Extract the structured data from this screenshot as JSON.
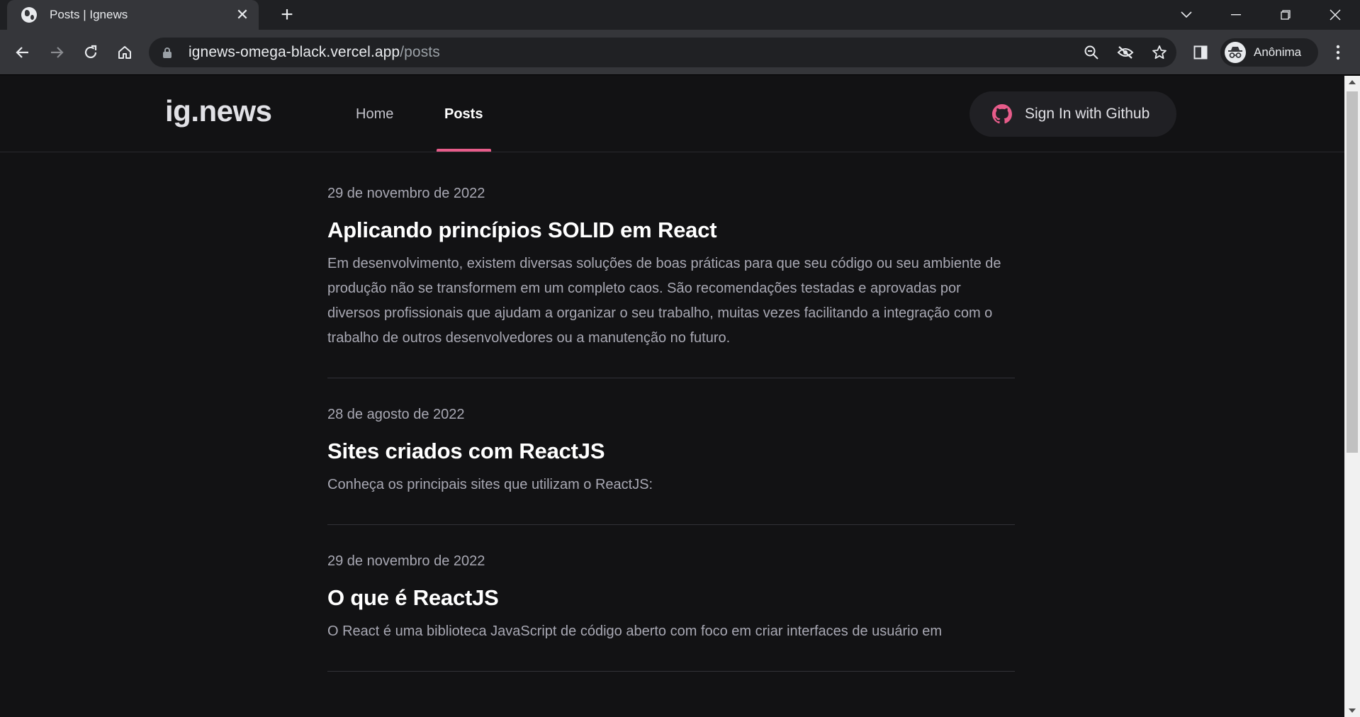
{
  "browser": {
    "tab_title": "Posts | Ignews",
    "url_host": "ignews-omega-black.vercel.app",
    "url_path": "/posts",
    "profile_label": "Anônima"
  },
  "header": {
    "logo": "ig.news",
    "nav": [
      {
        "label": "Home",
        "active": false
      },
      {
        "label": "Posts",
        "active": true
      }
    ],
    "signin_label": "Sign In with Github"
  },
  "posts": [
    {
      "date": "29 de novembro de 2022",
      "title": "Aplicando princípios SOLID em React",
      "excerpt": "Em desenvolvimento, existem diversas soluções de boas práticas para que seu código ou seu ambiente de produção não se transformem em um completo caos. São recomendações testadas e aprovadas por diversos profissionais que ajudam a organizar o seu trabalho, muitas vezes facilitando a integração com o trabalho de outros desenvolvedores ou a manutenção no futuro."
    },
    {
      "date": "28 de agosto de 2022",
      "title": "Sites criados com ReactJS",
      "excerpt": "Conheça os principais sites que utilizam o ReactJS:"
    },
    {
      "date": "29 de novembro de 2022",
      "title": "O que é ReactJS",
      "excerpt": "O React é uma biblioteca JavaScript de código aberto com foco em criar interfaces de usuário em"
    }
  ],
  "colors": {
    "background": "#121214",
    "accent": "#e75c8a",
    "button_bg": "#202024"
  }
}
